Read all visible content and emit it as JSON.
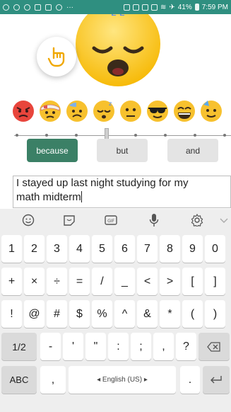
{
  "status_bar": {
    "battery": "41%",
    "time": "7:59 PM"
  },
  "emoji_row": [
    "angry-face",
    "face-with-head-bandage",
    "sad-sweating-face",
    "sleepy-face",
    "neutral-face",
    "cool-face-sunglasses",
    "grinning-face",
    "partying-face"
  ],
  "slider": {
    "ticks": 8,
    "selected_index": 3
  },
  "conjunctions": [
    {
      "label": "because",
      "active": true
    },
    {
      "label": "but",
      "active": false
    },
    {
      "label": "and",
      "active": false
    }
  ],
  "text_input": {
    "value_line1": "I stayed up last night studying for my",
    "value_line2": "math midterm"
  },
  "keyboard": {
    "toolbar": [
      "emoji-icon",
      "sticker-icon",
      "gif-icon",
      "mic-icon",
      "settings-icon",
      "collapse-icon"
    ],
    "gif_label": "GIF",
    "row1": [
      "1",
      "2",
      "3",
      "4",
      "5",
      "6",
      "7",
      "8",
      "9",
      "0"
    ],
    "row2": [
      "+",
      "×",
      "÷",
      "=",
      "/",
      "_",
      "<",
      ">",
      "[",
      "]"
    ],
    "row3": [
      "!",
      "@",
      "#",
      "$",
      "%",
      "^",
      "&",
      "*",
      "(",
      ")"
    ],
    "row4": {
      "shift": "1/2",
      "keys": [
        "-",
        "'",
        "\"",
        ":",
        ";",
        ",",
        "?"
      ]
    },
    "row5": {
      "mode": "ABC",
      "comma": ",",
      "space": "English (US)",
      "period": "."
    }
  }
}
